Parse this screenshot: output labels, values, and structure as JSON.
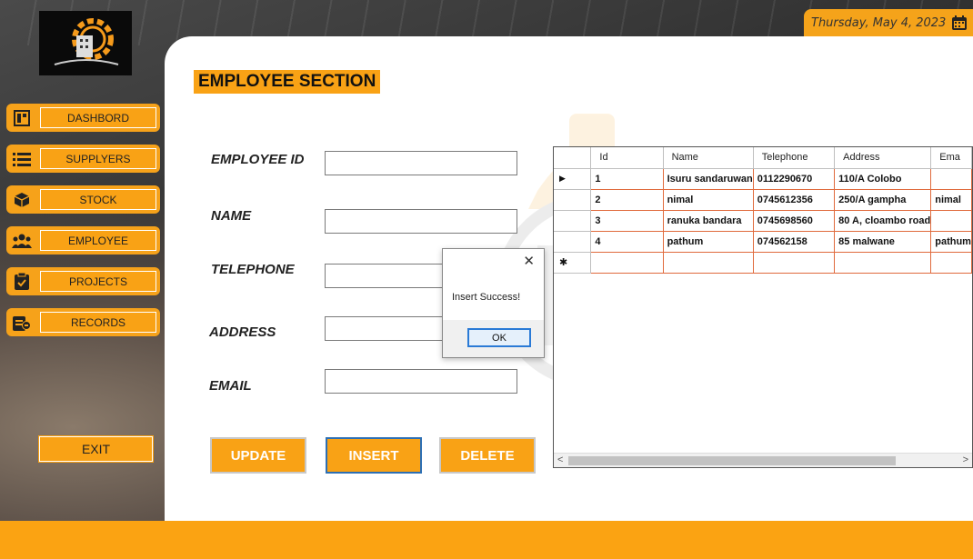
{
  "header": {
    "date": "Thursday, May 4, 2023"
  },
  "sidebar": {
    "items": [
      {
        "label": "DASHBORD",
        "icon": "dashboard-icon"
      },
      {
        "label": "SUPPLYERS",
        "icon": "list-icon"
      },
      {
        "label": "STOCK",
        "icon": "box-icon"
      },
      {
        "label": "EMPLOYEE",
        "icon": "users-icon"
      },
      {
        "label": "PROJECTS",
        "icon": "clipboard-icon"
      },
      {
        "label": "RECORDS",
        "icon": "records-icon"
      }
    ],
    "exit_label": "EXIT"
  },
  "main": {
    "title": "EMPLOYEE SECTION",
    "fields": [
      {
        "label": "EMPLOYEE ID",
        "value": ""
      },
      {
        "label": "NAME",
        "value": ""
      },
      {
        "label": "TELEPHONE",
        "value": ""
      },
      {
        "label": "ADDRESS",
        "value": ""
      },
      {
        "label": "EMAIL",
        "value": ""
      }
    ],
    "buttons": {
      "update": "UPDATE",
      "insert": "INSERT",
      "delete": "DELETE"
    }
  },
  "grid": {
    "columns": [
      "Id",
      "Name",
      "Telephone",
      "Address",
      "Ema"
    ],
    "rows": [
      [
        "1",
        "Isuru sandaruwan",
        "0112290670",
        "110/A Colobo",
        ""
      ],
      [
        "2",
        "nimal",
        "0745612356",
        "250/A gampha",
        "nimal"
      ],
      [
        "3",
        "ranuka bandara",
        "0745698560",
        "80 A, cloambo road",
        ""
      ],
      [
        "4",
        "pathum",
        "074562158",
        "85 malwane",
        "pathum"
      ]
    ],
    "new_row_marker": "✱",
    "current_row_marker": "▶"
  },
  "dialog": {
    "message": "Insert Success!",
    "ok_label": "OK",
    "close": "✕"
  },
  "colors": {
    "accent": "#f9a215",
    "footer": "#fba312",
    "panel": "#ffffff",
    "grid_border": "#e06a3c"
  }
}
